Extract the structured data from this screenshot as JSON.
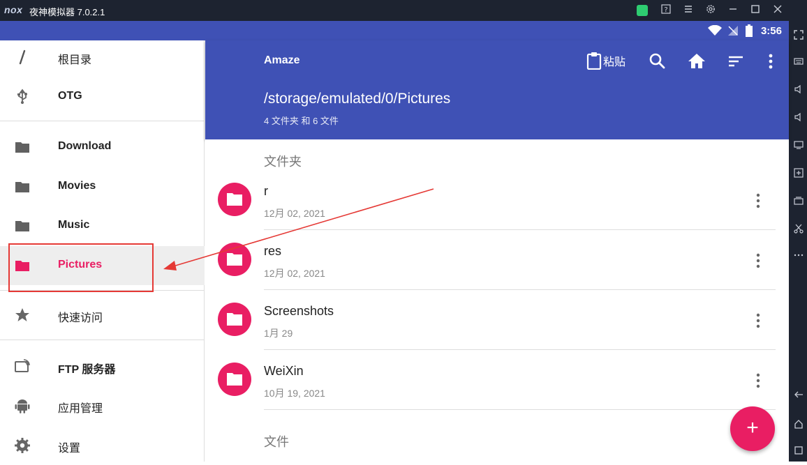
{
  "emulator": {
    "logo": "nox",
    "title": "夜神模拟器 7.0.2.1"
  },
  "status": {
    "time": "3:56"
  },
  "drawer": {
    "items": [
      {
        "label": "根目录",
        "icon": "slash-icon"
      },
      {
        "label": "OTG",
        "icon": "usb-icon"
      },
      {
        "label": "Download",
        "icon": "folder-icon"
      },
      {
        "label": "Movies",
        "icon": "folder-icon"
      },
      {
        "label": "Music",
        "icon": "folder-icon"
      },
      {
        "label": "Pictures",
        "icon": "folder-icon"
      },
      {
        "label": "快速访问",
        "icon": "star-icon"
      },
      {
        "label": "FTP 服务器",
        "icon": "ftp-icon"
      },
      {
        "label": "应用管理",
        "icon": "android-icon"
      },
      {
        "label": "设置",
        "icon": "gear-icon"
      }
    ]
  },
  "appbar": {
    "title": "Amaze",
    "paste_label": "粘贴",
    "path": "/storage/emulated/0/Pictures",
    "count": "4 文件夹 和 6 文件"
  },
  "list": {
    "folders_header": "文件夹",
    "files_header": "文件",
    "folders": [
      {
        "name": "r",
        "date": "12月 02, 2021"
      },
      {
        "name": "res",
        "date": "12月 02, 2021"
      },
      {
        "name": "Screenshots",
        "date": "1月 29"
      },
      {
        "name": "WeiXin",
        "date": "10月 19, 2021"
      }
    ]
  },
  "fab_label": "+",
  "colors": {
    "primary": "#3f51b5",
    "accent": "#e91e63",
    "annotation": "#e53935"
  }
}
